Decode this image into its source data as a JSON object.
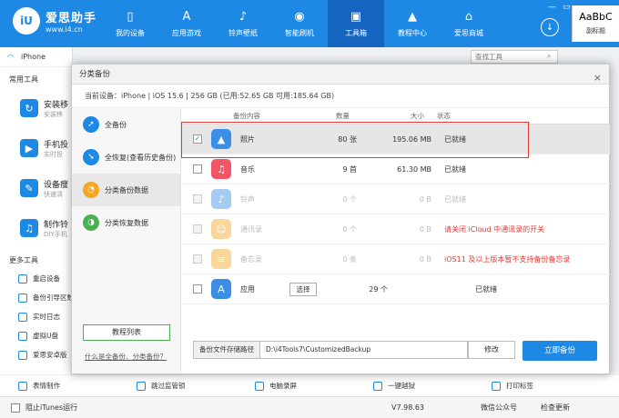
{
  "header": {
    "logo_mark": "iU",
    "logo_title": "爱思助手",
    "logo_url": "www.i4.cn",
    "nav": [
      {
        "label": "我的设备",
        "icon": "phone-icon"
      },
      {
        "label": "应用游戏",
        "icon": "appstore-icon"
      },
      {
        "label": "铃声壁纸",
        "icon": "bell-icon"
      },
      {
        "label": "智能刷机",
        "icon": "flash-icon"
      },
      {
        "label": "工具箱",
        "icon": "toolbox-icon"
      },
      {
        "label": "教程中心",
        "icon": "graduation-cap-icon"
      },
      {
        "label": "爱思商城",
        "icon": "store-icon"
      }
    ],
    "active_nav": "工具箱",
    "word_sample": "AaBbC",
    "word_style": "副标题"
  },
  "sidebar": {
    "device": "iPhone",
    "section_common": "常用工具",
    "tools": [
      {
        "name": "安装移",
        "desc": "安装移"
      },
      {
        "name": "手机投",
        "desc": "实时投"
      },
      {
        "name": "设备瘦",
        "desc": "快速清"
      },
      {
        "name": "制作铃",
        "desc": "DIY手机"
      }
    ],
    "section_more": "更多工具",
    "more": [
      "重启设备",
      "备份引导区数",
      "实时日志",
      "虚拟U盘",
      "爱思安卓版",
      "表情制作"
    ]
  },
  "search": {
    "placeholder": "查找工具"
  },
  "bottom_tools": [
    "跳过监管锁",
    "电脑录屏",
    "一键越狱",
    "打印标签"
  ],
  "status_bar": {
    "itunes": "阻止iTunes运行",
    "version": "V7.98.63",
    "wechat": "微信公众号",
    "update": "检查更新"
  },
  "modal": {
    "title": "分类备份",
    "device_info": "当前设备：iPhone  |  iOS 15.6  |  256 GB (已用:52.65 GB 可用:185.64 GB)",
    "menu": [
      {
        "label": "全备份",
        "color": "#1e88e5"
      },
      {
        "label": "全恢复(查看历史备份)",
        "color": "#1e88e5"
      },
      {
        "label": "分类备份数据",
        "color": "#f5a623"
      },
      {
        "label": "分类恢复数据",
        "color": "#4caf50"
      }
    ],
    "tutorial_btn": "教程列表",
    "help_link": "什么是全备份、分类备份？",
    "columns": {
      "name": "备份内容",
      "count": "数量",
      "size": "大小",
      "status": "状态"
    },
    "rows": [
      {
        "name": "照片",
        "count": "80 张",
        "size": "195.06 MB",
        "status": "已就绪",
        "checked": true,
        "disabled": false,
        "warn": false,
        "icon": "photos-icon",
        "color": "#3a8ee6"
      },
      {
        "name": "音乐",
        "count": "9 首",
        "size": "61.30 MB",
        "status": "已就绪",
        "checked": false,
        "disabled": false,
        "warn": false,
        "icon": "music-icon",
        "color": "#f25566"
      },
      {
        "name": "铃声",
        "count": "0 个",
        "size": "0 B",
        "status": "已就绪",
        "checked": false,
        "disabled": true,
        "warn": false,
        "icon": "bell-icon",
        "color": "#3a8ee6"
      },
      {
        "name": "通讯录",
        "count": "0 个",
        "size": "0 B",
        "status": "请关闭 iCloud 中通讯录的开关",
        "checked": false,
        "disabled": true,
        "warn": true,
        "icon": "contacts-icon",
        "color": "#f5a623"
      },
      {
        "name": "备忘录",
        "count": "0 条",
        "size": "0 B",
        "status": "iOS11 及以上版本暂不支持备份备忘录",
        "checked": false,
        "disabled": true,
        "warn": true,
        "icon": "notes-icon",
        "color": "#f5a623"
      },
      {
        "name": "应用",
        "count": "29 个",
        "size": "",
        "status": "已就绪",
        "checked": false,
        "disabled": false,
        "warn": false,
        "icon": "appstore-icon",
        "color": "#3a8ee6",
        "select_label": "选择"
      }
    ],
    "path_label": "备份文件存储路径",
    "path_value": "D:\\i4Tools7\\CustomizedBackup",
    "modify_btn": "修改",
    "backup_btn": "立即备份"
  }
}
